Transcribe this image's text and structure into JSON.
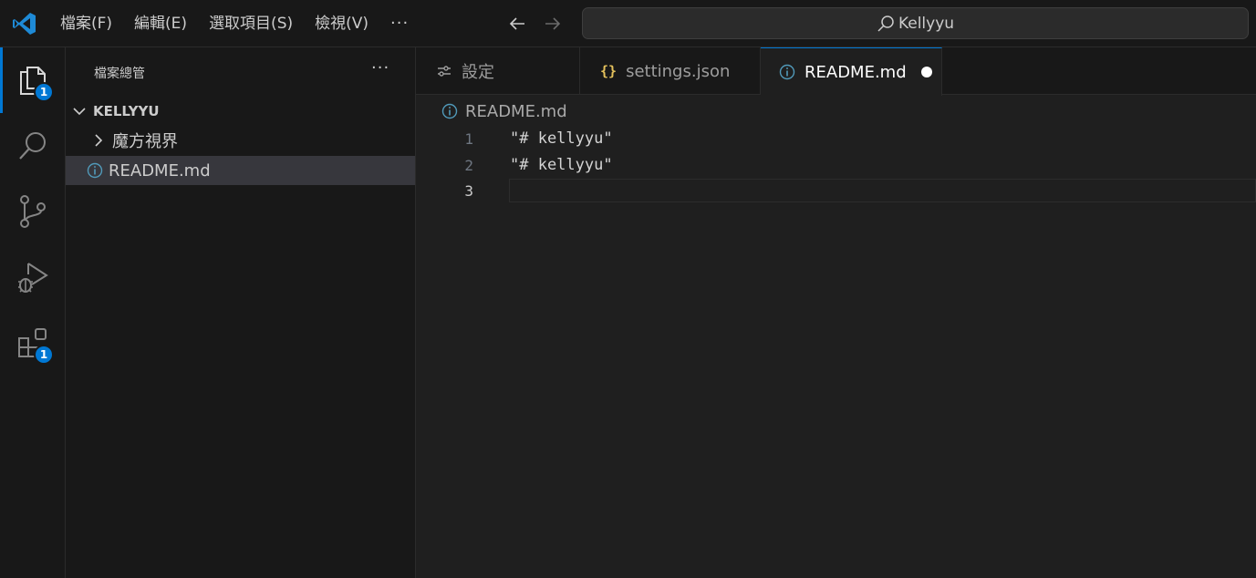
{
  "menu": {
    "items": [
      "檔案(F)",
      "編輯(E)",
      "選取項目(S)",
      "檢視(V)"
    ],
    "more": "···"
  },
  "search": {
    "text": "Kellyyu"
  },
  "activity": {
    "explorer_badge": "1",
    "extensions_badge": "1"
  },
  "sidebar": {
    "title": "檔案總管",
    "more": "···",
    "root": "KELLYYU",
    "items": [
      {
        "label": "魔方視界",
        "type": "folder"
      },
      {
        "label": "README.md",
        "type": "file"
      }
    ]
  },
  "tabs": [
    {
      "label": "設定",
      "icon": "settings-icon"
    },
    {
      "label": "settings.json",
      "icon": "json-icon"
    },
    {
      "label": "README.md",
      "icon": "info-icon",
      "modified": true
    }
  ],
  "breadcrumb": {
    "file": "README.md"
  },
  "editor": {
    "lines": [
      {
        "number": "1",
        "text": "\"# kellyyu\""
      },
      {
        "number": "2",
        "text": "\"# kellyyu\""
      },
      {
        "number": "3",
        "text": ""
      }
    ]
  },
  "colors": {
    "accent": "#0078d4",
    "background": "#1f1f1f",
    "sidebar": "#181818"
  }
}
